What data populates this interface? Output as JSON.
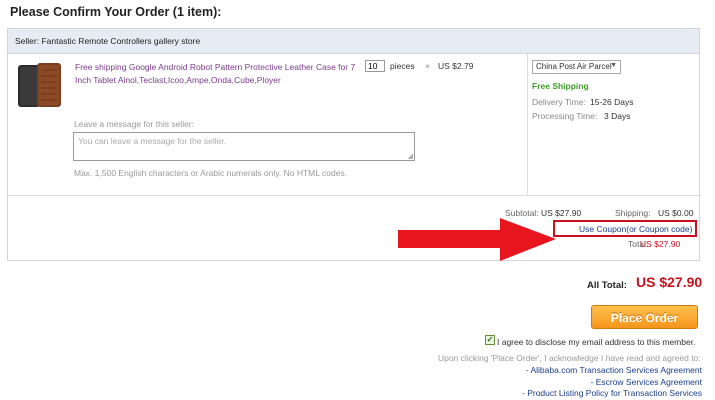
{
  "page": {
    "title": "Please Confirm Your Order (1 item):"
  },
  "seller": {
    "label": "Seller: Fantastic Remote Controllers gallery store"
  },
  "product": {
    "image_icon": "leather-case-icon",
    "title": "Free shipping Google Android Robot Pattern Protective Leather Case for 7 Inch Tablet Ainol,Teclast,Icoo,Ampe,Onda,Cube,Ployer",
    "quantity": "10",
    "unit": "pieces",
    "times": "×",
    "unit_price": "US $2.79"
  },
  "shipping": {
    "method": "China Post Air Parcel",
    "free_label": "Free Shipping",
    "delivery_label": "Delivery Time:",
    "delivery_value": "15-26 Days",
    "processing_label": "Processing Time:",
    "processing_value": "3 Days"
  },
  "message": {
    "label": "Leave a message for this seller:",
    "placeholder": "You can leave a message for the seller.",
    "hint": "Max. 1,500 English characters or Arabic numerals only. No HTML codes."
  },
  "summary": {
    "subtotal_label": "Subtotal:",
    "subtotal_value": "US $27.90",
    "shipping_label": "Shipping:",
    "shipping_value": "US $0.00",
    "coupon_link": "Use Coupon(or Coupon code)",
    "total_label": "Total:",
    "total_value": "US $27.90"
  },
  "order": {
    "all_total_label": "All Total:",
    "all_total_value": "US $27.90",
    "place_order": "Place Order",
    "agree_label": "I agree to disclose my email address to this member.",
    "agree_checked": true,
    "agreement_intro": "Upon clicking 'Place Order', I acknowledge I have read and agreed to:",
    "agreements": [
      "- Alibaba.com Transaction Services Agreement",
      "- Escrow Services Agreement",
      "- Product Listing Policy for Transaction Services"
    ]
  },
  "colors": {
    "accent_red": "#c8101e",
    "link_blue": "#1a3e8c",
    "free_green": "#3e9f27",
    "button_orange": "#f6951d"
  }
}
